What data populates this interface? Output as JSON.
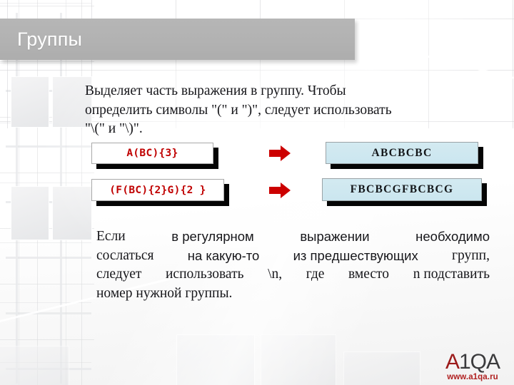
{
  "slide": {
    "title": "Группы",
    "title_color": "#b2b2b2",
    "title_text_color": "#ffffff"
  },
  "paragraph_top": {
    "line1": "Выделяет часть выражения в группу. Чтобы",
    "line2": "определить символы \"(\" и \")\", следует использовать",
    "line3": "\"\\(\" и \"\\)\"."
  },
  "paragraph_bottom": {
    "line1_a": "Если",
    "line1_b": "в регулярном",
    "line1_c": "выражении",
    "line1_d": "необходимо",
    "line2_a": "сослаться",
    "line2_b": "на какую-то",
    "line2_c": "из предшествующих",
    "line2_d": "групп,",
    "line3_a": "следует",
    "line3_b": "использовать",
    "line3_c": "\\n,",
    "line3_d": "где",
    "line3_e": "вместо",
    "line3_f": "n подставить",
    "line4": "номер нужной группы."
  },
  "diagram": {
    "input_color": "#c00000",
    "output_fill": "#cbe6ef",
    "arrow_color": "#cc0000",
    "rows": [
      {
        "input": "A(BC){3}",
        "arrow": "right-arrow-icon",
        "output": "ABCBCBC"
      },
      {
        "input": "(F(BC){2}G){2 }",
        "arrow": "right-arrow-icon",
        "output": "FBCBCGFBCBCG"
      }
    ]
  },
  "logo": {
    "mark_a": "A",
    "mark_1": "1",
    "mark_qa": "QA",
    "url": "www.a1qa.ru",
    "accent_color": "#9c1b1b",
    "url_color": "#b02020"
  }
}
